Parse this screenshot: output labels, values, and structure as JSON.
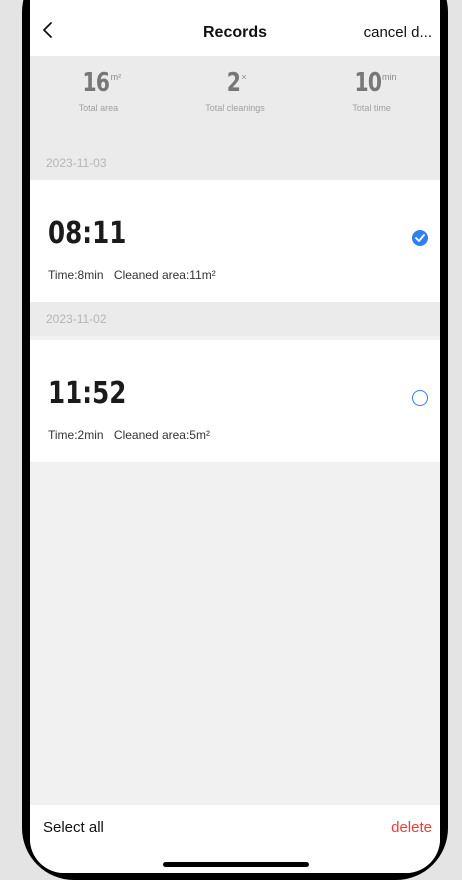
{
  "header": {
    "title": "Records",
    "action": "cancel d..."
  },
  "stats": [
    {
      "value": "16",
      "unit": "m²",
      "label": "Total area"
    },
    {
      "value": "2",
      "unit": "×",
      "label": "Total cleanings"
    },
    {
      "value": "10",
      "unit": "min",
      "label": "Total time"
    }
  ],
  "groups": [
    {
      "date": "2023-11-03",
      "record": {
        "time": "08:11",
        "duration": "Time:8min",
        "area": "Cleaned area:11m²",
        "selected": true
      }
    },
    {
      "date": "2023-11-02",
      "record": {
        "time": "11:52",
        "duration": "Time:2min",
        "area": "Cleaned area:5m²",
        "selected": false
      }
    }
  ],
  "footer": {
    "select_all": "Select all",
    "delete": "delete"
  },
  "colors": {
    "accent": "#2f7ff0",
    "danger": "#f23a3a"
  },
  "icons": {
    "back": "chevron-left-icon",
    "check": "check-icon"
  }
}
